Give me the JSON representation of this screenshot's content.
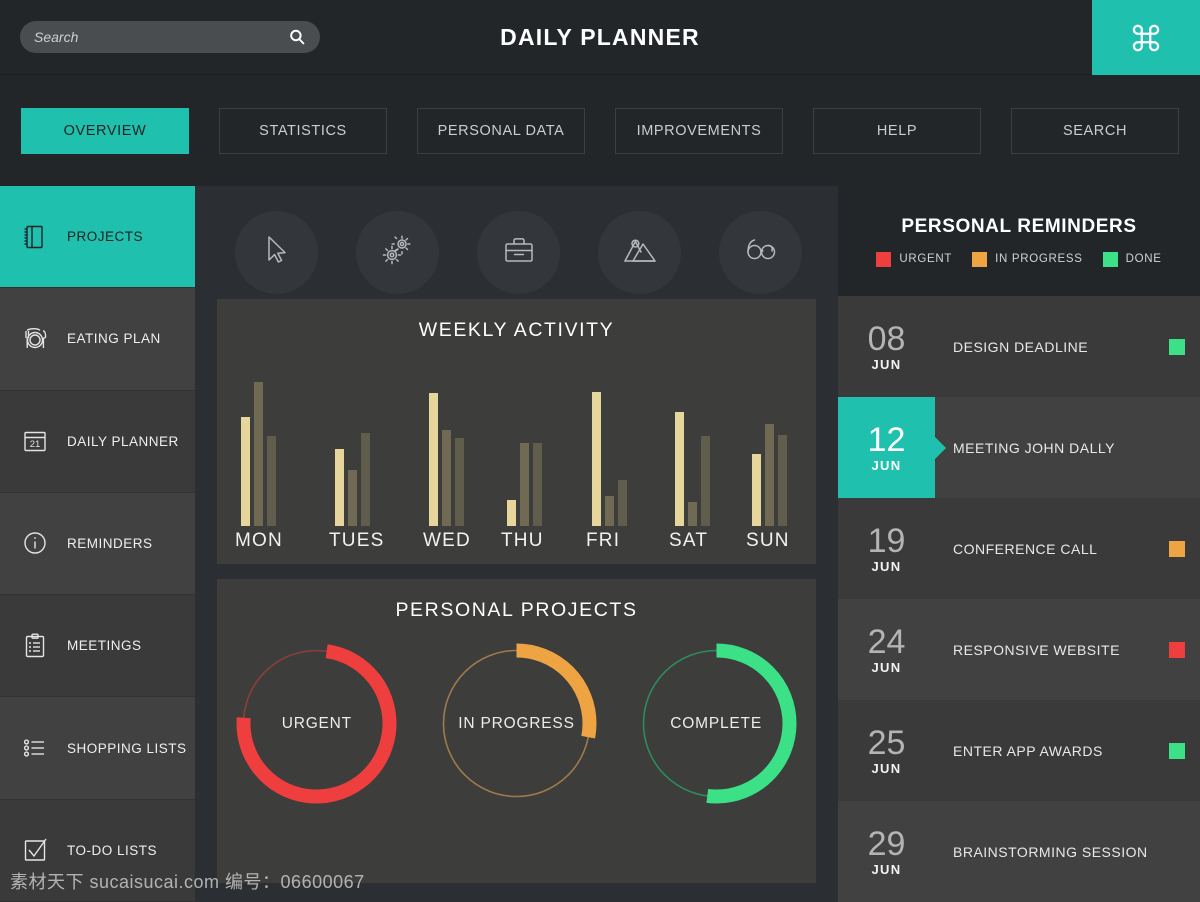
{
  "header": {
    "title": "DAILY PLANNER",
    "search": {
      "placeholder": "Search",
      "value": ""
    },
    "command_icon": "command-icon"
  },
  "tabs": [
    {
      "label": "OVERVIEW",
      "active": true
    },
    {
      "label": "STATISTICS",
      "active": false
    },
    {
      "label": "PERSONAL DATA",
      "active": false
    },
    {
      "label": "IMPROVEMENTS",
      "active": false
    },
    {
      "label": "HELP",
      "active": false
    },
    {
      "label": "SEARCH",
      "active": false
    }
  ],
  "sidebar": {
    "items": [
      {
        "label": "PROJECTS",
        "icon": "notebook-icon",
        "active": true
      },
      {
        "label": "EATING PLAN",
        "icon": "cutlery-plate-icon",
        "active": false
      },
      {
        "label": "DAILY PLANNER",
        "icon": "calendar-21-icon",
        "active": false
      },
      {
        "label": "REMINDERS",
        "icon": "info-circle-icon",
        "active": false
      },
      {
        "label": "MEETINGS",
        "icon": "clipboard-icon",
        "active": false
      },
      {
        "label": "SHOPPING LISTS",
        "icon": "bullet-list-icon",
        "active": false
      },
      {
        "label": "TO-DO LISTS",
        "icon": "checkbox-check-icon",
        "active": false
      }
    ]
  },
  "quick_actions": [
    {
      "icon": "cursor-arrow-icon",
      "name": "cursor"
    },
    {
      "icon": "gears-icon",
      "name": "settings"
    },
    {
      "icon": "briefcase-icon",
      "name": "work"
    },
    {
      "icon": "mountains-icon",
      "name": "photos"
    },
    {
      "icon": "glasses-icon",
      "name": "reading"
    }
  ],
  "chart_data": [
    {
      "type": "bar",
      "title": "WEEKLY ACTIVITY",
      "categories": [
        "MON",
        "TUES",
        "WED",
        "THU",
        "FRI",
        "SAT",
        "SUN"
      ],
      "series": [
        {
          "name": "primary",
          "color": "#e7d69b",
          "values": [
            68,
            48,
            83,
            16,
            84,
            71,
            45
          ]
        },
        {
          "name": "secondary",
          "color": "#706a55",
          "values": [
            90,
            35,
            60,
            52,
            19,
            15,
            64
          ]
        },
        {
          "name": "tertiary",
          "color": "#615d4d",
          "values": [
            56,
            58,
            55,
            52,
            29,
            56,
            57
          ]
        }
      ],
      "xlabel": "",
      "ylabel": "",
      "ylim": [
        0,
        100
      ],
      "grid": false,
      "legend": "none"
    },
    {
      "type": "pie",
      "title": "PERSONAL PROJECTS",
      "donuts": [
        {
          "label": "URGENT",
          "percent": 74,
          "color": "#ef3e3e",
          "track": "#8a3e3e",
          "start_deg": 8
        },
        {
          "label": "IN PROGRESS",
          "percent": 28,
          "color": "#efa443",
          "track": "#a07a4c",
          "start_deg": 0
        },
        {
          "label": "COMPLETE",
          "percent": 52,
          "color": "#3ce087",
          "track": "#2f8a5d",
          "start_deg": 0
        }
      ]
    }
  ],
  "reminders": {
    "title": "PERSONAL REMINDERS",
    "legend": [
      {
        "label": "URGENT",
        "color": "#ef3e3e"
      },
      {
        "label": "IN PROGRESS",
        "color": "#efa443"
      },
      {
        "label": "DONE",
        "color": "#3ce087"
      }
    ],
    "items": [
      {
        "day": "08",
        "month": "JUN",
        "text": "DESIGN DEADLINE",
        "status_color": "#3ce087",
        "highlight": false
      },
      {
        "day": "12",
        "month": "JUN",
        "text": "MEETING JOHN DALLY",
        "status_color": "",
        "highlight": true
      },
      {
        "day": "19",
        "month": "JUN",
        "text": "CONFERENCE CALL",
        "status_color": "#efa443",
        "highlight": false
      },
      {
        "day": "24",
        "month": "JUN",
        "text": "RESPONSIVE WEBSITE",
        "status_color": "#ef3e3e",
        "highlight": false
      },
      {
        "day": "25",
        "month": "JUN",
        "text": "ENTER APP AWARDS",
        "status_color": "#3ce087",
        "highlight": false
      },
      {
        "day": "29",
        "month": "JUN",
        "text": "BRAINSTORMING SESSION",
        "status_color": "",
        "highlight": false
      }
    ]
  },
  "watermark": "素材天下 sucaisucai.com  编号：06600067",
  "colors": {
    "accent_teal": "#1fc0ae",
    "bg_dark": "#222629",
    "bg_center": "#2b2f33",
    "panel": "#3d3d3b",
    "sidebar": "#3a3a3a"
  }
}
